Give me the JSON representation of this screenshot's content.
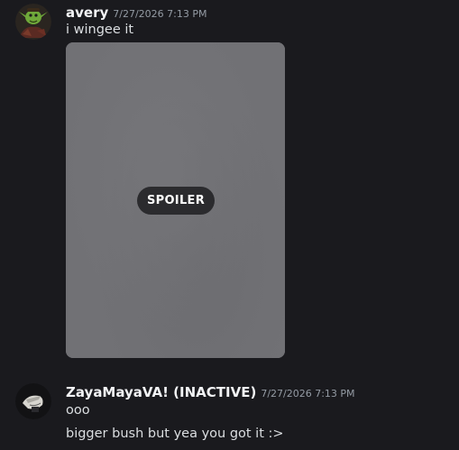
{
  "messages": [
    {
      "username": "avery",
      "timestamp": "7/27/2026 7:13 PM",
      "lines": [
        "i wingee it"
      ],
      "attachment": {
        "spoiler_label": "SPOILER"
      },
      "avatar_icon": "goblin-avatar-icon"
    },
    {
      "username": "ZayaMayaVA! (INACTIVE)",
      "timestamp": "7/27/2026 7:13 PM",
      "lines": [
        "ooo",
        "bigger bush but yea you got it :>"
      ],
      "avatar_icon": "character-avatar-icon"
    }
  ],
  "colors": {
    "background": "#1a1a1e",
    "username": "#f2f3f5",
    "timestamp": "#949ba4",
    "message_text": "#dbdee1",
    "spoiler_fill": "#707074",
    "spoiler_badge": "#2b2b2e"
  }
}
